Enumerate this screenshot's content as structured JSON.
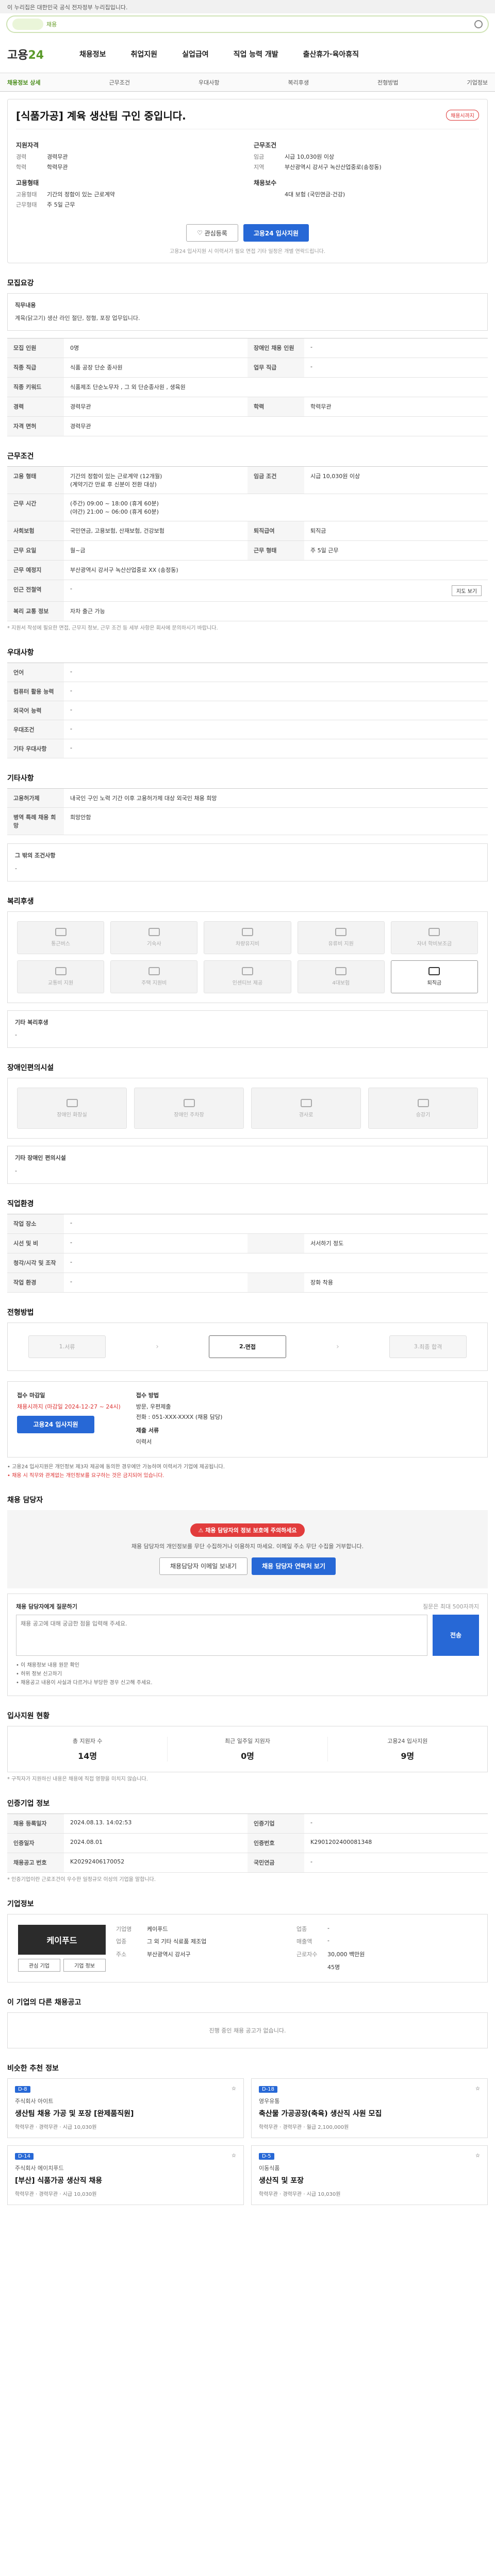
{
  "top": {
    "gov_text": "이 누리집은 대한민국 공식 전자정부 누리집입니다.",
    "search_tag": "채용"
  },
  "header": {
    "logo_a": "고용",
    "logo_b": "24",
    "gnb": [
      "채용정보",
      "취업지원",
      "실업급여",
      "직업 능력 개발",
      "출산휴가·육아휴직"
    ]
  },
  "subnav": {
    "items": [
      "채용정보 상세",
      "근무조건",
      "우대사항",
      "복리후생",
      "전형방법",
      "기업정보"
    ],
    "active": 0
  },
  "job": {
    "title": "[식품가공] 계육 생산팀 구인 중입니다.",
    "badge": "채용시까지",
    "sec_labels": {
      "cond": "지원자격",
      "area": "근무조건",
      "company": "고용형태",
      "pay": "채용보수"
    },
    "left": [
      {
        "k": "경력",
        "v": "경력무관"
      },
      {
        "k": "학력",
        "v": "학력무관"
      }
    ],
    "right": [
      {
        "k": "임금",
        "v": "시급 10,030원 이상"
      },
      {
        "k": "지역",
        "v": "부산광역시 강서구 녹산산업중로(송정동)"
      }
    ],
    "left2": [
      {
        "k": "고용형태",
        "v": "기간의 정함이 있는 근로계약"
      },
      {
        "k": "근무형태",
        "v": "주 5일 근무"
      }
    ],
    "right2": [
      {
        "k": "",
        "v": "4대 보험 (국민연금·건강)"
      }
    ],
    "btn_fav": "관심등록",
    "btn_apply": "고용24 입사지원",
    "note": "고용24 입사지원 시 이력서가 필요 면접 기타 일정은 개별 연락드립니다."
  },
  "desc": {
    "title": "모집요강",
    "label": "직무내용",
    "text": "계육(닭고기) 생산 라인 절단, 정형, 포장 업무입니다."
  },
  "req": {
    "rows": [
      [
        "모집 인원",
        "0명",
        "장애인 채용 인원",
        "-"
      ],
      [
        "직종 직급",
        "식품 공장 단순 종사원",
        "업무 직급",
        "-"
      ],
      [
        "직종 키워드",
        "식품제조 단순노무자 , 그 외 단순종사원 , 생육원",
        "",
        ""
      ],
      [
        "경력",
        "경력무관",
        "학력",
        "학력무관"
      ],
      [
        "자격 면허",
        "경력무관",
        "",
        ""
      ]
    ]
  },
  "work": {
    "title": "근무조건",
    "rows": [
      [
        "고용 형태",
        "기간의 정함이 있는 근로계약 (12개월)\n(계약기간 만료 후 신분이 전환 대상)",
        "임금 조건",
        "시급 10,030원 이상"
      ],
      [
        "근무 시간",
        "(주간) 09:00 ~ 18:00 (휴게 60분)\n(야간) 21:00 ~ 06:00 (휴게 60분)",
        "",
        ""
      ],
      [
        "사회보험",
        "국민연금, 고용보험, 산재보험, 건강보험",
        "퇴직급여",
        "퇴직금"
      ],
      [
        "근무 요일",
        "월~금",
        "근무 형태",
        "주 5일 근무"
      ],
      [
        "근무 예정지",
        "부산광역시 강서구 녹산산업중로 XX (송정동)",
        "",
        ""
      ],
      [
        "인근 전철역",
        "-",
        "",
        ""
      ],
      [
        "복리 교통 정보",
        "자차 출근 가능",
        "",
        ""
      ]
    ],
    "map_btn": "지도 보기",
    "note": "* 지원서 작성에 필요한 면접, 근무지 정보, 근무 조건 등 세부 사항은 회사에 문의하시기 바랍니다."
  },
  "pref": {
    "title": "우대사항",
    "rows": [
      [
        "언어",
        "-"
      ],
      [
        "컴퓨터 활용 능력",
        "-"
      ],
      [
        "외국어 능력",
        "-"
      ],
      [
        "우대조건",
        "-"
      ],
      [
        "기타 우대사항",
        "-"
      ]
    ]
  },
  "etc": {
    "title": "기타사항",
    "rows": [
      [
        "고용허가제",
        "내국인 구인 노력 기간 이후 고용허가제 대상 외국인 채용 희망"
      ],
      [
        "병역 특례 채용 희망",
        "희망안함"
      ]
    ]
  },
  "other_cond": {
    "label": "그 밖의 조건사항",
    "value": "-"
  },
  "welfare": {
    "title": "복리후생",
    "items": [
      "통근버스",
      "기숙사",
      "차량유지비",
      "유류비 지원",
      "자녀 학비보조금",
      "교통비 지원",
      "주택 지원비",
      "인센티브 제공",
      "4대보험",
      "퇴직금"
    ],
    "active": 9,
    "etc_label": "기타 복리후생",
    "etc_value": "-"
  },
  "disab": {
    "title": "장애인편의시설",
    "items": [
      "장애인 화장실",
      "장애인 주차장",
      "경사로",
      "승강기"
    ],
    "etc_label": "기타 장애인 편의시설",
    "etc_value": "-"
  },
  "req2": {
    "title": "직업환경",
    "rows": [
      [
        "작업 장소",
        "-",
        "",
        ""
      ],
      [
        "시선 및 비",
        "-",
        "",
        "서서하기 정도"
      ],
      [
        "청각/시각 및 조작",
        "-",
        "",
        ""
      ],
      [
        "작업 환경",
        "-",
        "",
        "장화 착용"
      ]
    ]
  },
  "selection": {
    "title": "전형방법",
    "steps": [
      "서류",
      "면접",
      "최종 합격"
    ],
    "active": 1
  },
  "apply": {
    "c1_t": "접수 마감일",
    "c1_red": "채용시까지 (마감일 2024-12-27 ~ 24시)",
    "c1_btn": "고용24 입사지원",
    "c2_t": "접수 방법",
    "c2_vals": [
      "방문, 우편제출",
      "전화 : 051-XXX-XXXX (채용 담당)"
    ],
    "c2_sub_t": "제출 서류",
    "c2_sub_v": "이력서",
    "warns": [
      "고용24 입사지원은 개인정보 제3자 제공에 동의한 경우에만 가능하며 이력서가 기업에 제공됩니다.",
      "채용 시 직무와 관계없는 개인정보를 요구하는 것은 금지되어 있습니다."
    ]
  },
  "contact": {
    "title": "채용 담당자",
    "pill": "채용 담당자의 정보 보호에 주의하세요",
    "msg": "채용 담당자의 개인정보를 무단 수집하거나 이용하지 마세요. 이메일 주소 무단 수집을 거부합니다.",
    "btn1": "채용담당자 이메일 보내기",
    "btn2": "채용 담당자 연락처 보기",
    "qa_t": "채용 담당자에게 질문하기",
    "qa_sub": "질문은 최대 500자까지",
    "qa_ph": "채용 공고에 대해 궁금한 점을 입력해 주세요.",
    "qa_send": "전송",
    "notes": [
      "이 채용정보 내용 원문 확인",
      "허위 정보 신고하기",
      "채용공고 내용이 사실과 다르거나 부당한 경우 신고해 주세요."
    ]
  },
  "stats": {
    "title": "입사지원 현황",
    "items": [
      {
        "t": "총 지원자 수",
        "n": "14명"
      },
      {
        "t": "최근 일주일 지원자",
        "n": "0명"
      },
      {
        "t": "고용24 입사지원",
        "n": "9명"
      }
    ],
    "note": "* 구직자가 지원하신 내용은 채용에 직접 영향을 미치지 않습니다."
  },
  "reg": {
    "title": "인증기업 정보",
    "rows": [
      [
        "채용 등록일자",
        "2024.08.13. 14:02:53",
        "인증기업",
        "-"
      ],
      [
        "인증일자",
        "2024.08.01",
        "인증번호",
        "K2901202400081348"
      ],
      [
        "채용공고 번호",
        "K20292406170052",
        "국민연금",
        "-"
      ]
    ],
    "note": "* 인증기업이란 근로조건이 우수한 일정규모 이상의 기업을 말합니다."
  },
  "co": {
    "title": "기업정보",
    "logo": "케이푸드",
    "btn1": "관심 기업",
    "btn2": "기업 정보",
    "info": [
      [
        "기업명",
        "케이푸드",
        "업종",
        "-"
      ],
      [
        "업종",
        "그 외 기타 식료품 제조업",
        "매출액",
        "-"
      ],
      [
        "주소",
        "부산광역시 강서구",
        "근로자수",
        "30,000 백만원"
      ],
      [
        "",
        "",
        "",
        "45명"
      ]
    ]
  },
  "same": {
    "title": "이 기업의 다른 채용공고",
    "empty": "진행 중인 채용 공고가 없습니다."
  },
  "recommend": {
    "title": "비슷한 추천 정보",
    "cards": [
      {
        "dd": "D-8",
        "name": "주식회사 아이트",
        "title": "생산팀 채용 가공 및 포장 [완제품직원]",
        "meta": "학력무관 · 경력무관 · 시급 10,030원"
      },
      {
        "dd": "D-18",
        "name": "영우유통",
        "title": "축산물 가공공장(축육) 생산직 사원 모집",
        "meta": "학력무관 · 경력무관 · 월급 2,100,000원"
      },
      {
        "dd": "D-14",
        "name": "주식회사 에이치푸드",
        "title": "[부산] 식품가공 생산직 채용",
        "meta": "학력무관 · 경력무관 · 시급 10,030원"
      },
      {
        "dd": "D-5",
        "name": "이동식품",
        "title": "생산직 및 포장",
        "meta": "학력무관 · 경력무관 · 시급 10,030원"
      }
    ]
  }
}
